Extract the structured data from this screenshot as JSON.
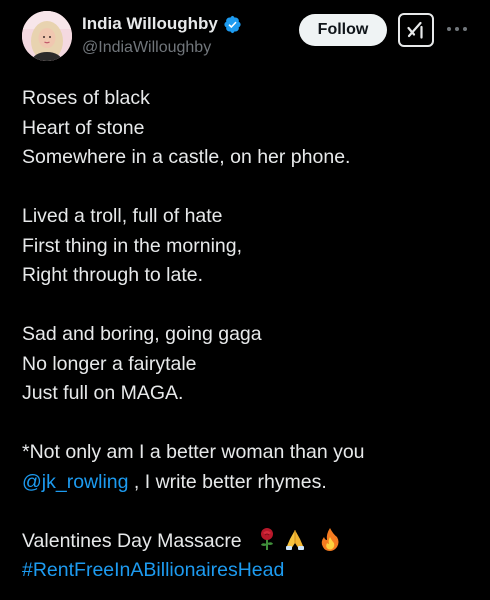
{
  "author": {
    "display_name": "India Willoughby",
    "handle": "@IndiaWilloughby",
    "verified": true
  },
  "actions": {
    "follow_label": "Follow",
    "grok_icon": "grok-icon",
    "more_icon": "more-horizontal-icon"
  },
  "tweet": {
    "stanza1": [
      "Roses of black",
      "Heart of stone",
      "Somewhere in a castle, on her phone."
    ],
    "stanza2": [
      "Lived a troll, full of hate",
      "First thing in the morning,",
      "Right through to late."
    ],
    "stanza3": [
      "Sad and boring, going gaga",
      "No longer a fairytale",
      "Just full on MAGA."
    ],
    "note_line1": "*Not only am I a better woman than you",
    "mention": "@jk_rowling",
    "note_line2_rest": " , I write better rhymes.",
    "closing_text": "Valentines Day Massacre",
    "emojis": [
      "rose-emoji",
      "folded-hands-emoji",
      "fire-emoji"
    ],
    "hashtag": "#RentFreeInABillionairesHead"
  },
  "colors": {
    "background": "#000000",
    "text": "#e7e9ea",
    "secondary": "#71767b",
    "link": "#1d9bf0",
    "verified": "#1d9bf0"
  }
}
